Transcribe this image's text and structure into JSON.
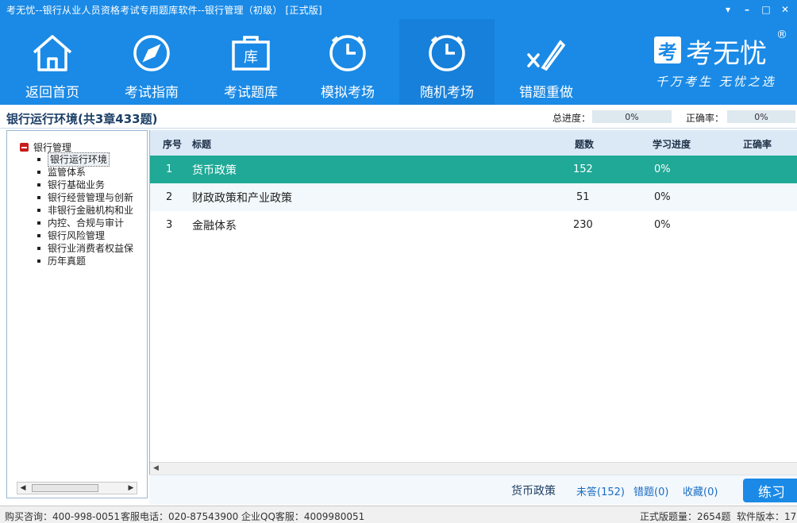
{
  "window": {
    "title": "考无忧--银行从业人员资格考试专用题库软件--银行管理（初级） [正式版]",
    "controls": [
      "▾",
      "–",
      "□",
      "✕"
    ]
  },
  "nav": {
    "items": [
      {
        "label": "返回首页",
        "icon": "home-icon"
      },
      {
        "label": "考试指南",
        "icon": "compass-icon"
      },
      {
        "label": "考试题库",
        "icon": "question-bank-icon"
      },
      {
        "label": "模拟考场",
        "icon": "clock-icon"
      },
      {
        "label": "随机考场",
        "icon": "clock-icon"
      },
      {
        "label": "错题重做",
        "icon": "redo-mistakes-icon"
      }
    ],
    "active_index": 4
  },
  "brand": {
    "logo_char": "考",
    "name": "考无忧",
    "reg": "®",
    "slogan": "千万考生  无忧之选"
  },
  "section": {
    "title": "银行运行环境(共3章433题)",
    "total_progress_label": "总进度：",
    "total_progress_value": "0%",
    "accuracy_label": "正确率：",
    "accuracy_value": "0%"
  },
  "tree": {
    "root": "银行管理",
    "items": [
      "银行运行环境",
      "监管体系",
      "银行基础业务",
      "银行经营管理与创新",
      "非银行金融机构和业",
      "内控、合规与审计",
      "银行风险管理",
      "银行业消费者权益保",
      "历年真题"
    ],
    "selected_index": 0
  },
  "table": {
    "headers": {
      "index": "序号",
      "title": "标题",
      "count": "题数",
      "progress": "学习进度",
      "accuracy": "正确率"
    },
    "rows": [
      {
        "index": "1",
        "title": "货币政策",
        "count": "152",
        "progress": "0%",
        "accuracy": ""
      },
      {
        "index": "2",
        "title": "财政政策和产业政策",
        "count": "51",
        "progress": "0%",
        "accuracy": ""
      },
      {
        "index": "3",
        "title": "金融体系",
        "count": "230",
        "progress": "0%",
        "accuracy": ""
      }
    ],
    "active_row": 0
  },
  "action_bar": {
    "current": "货币政策",
    "unanswered": "未答(152)",
    "wrong": "错题(0)",
    "favorites": "收藏(0)",
    "practice": "练习"
  },
  "status": {
    "purchase": "购买咨询：400-998-0051",
    "service_phone": "客服电话：020-87543900",
    "qq_service": "企业QQ客服：4009980051",
    "question_count": "正式版题量：2654题",
    "version": "软件版本：17"
  },
  "colors": {
    "primary": "#1a8ae6",
    "active_row": "#1fa996",
    "header_bg": "#dbe9f6"
  }
}
